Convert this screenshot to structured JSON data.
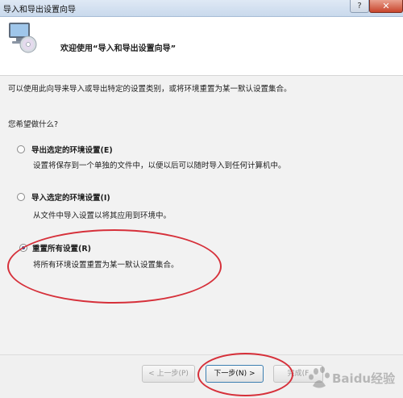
{
  "window": {
    "title": "导入和导出设置向导"
  },
  "header": {
    "title": "欢迎使用“导入和导出设置向导”"
  },
  "main": {
    "intro": "可以使用此向导来导入或导出特定的设置类别，或将环境重置为某一默认设置集合。",
    "question": "您希望做什么?",
    "options": [
      {
        "label": "导出选定的环境设置(E)",
        "desc": "设置将保存到一个单独的文件中，以便以后可以随时导入到任何计算机中。",
        "selected": false
      },
      {
        "label": "导入选定的环境设置(I)",
        "desc": "从文件中导入设置以将其应用到环境中。",
        "selected": false
      },
      {
        "label": "重置所有设置(R)",
        "desc": "将所有环境设置重置为某一默认设置集合。",
        "selected": true
      }
    ]
  },
  "footer": {
    "back": "< 上一步(P)",
    "next": "下一步(N) >",
    "finish": "完成(F"
  },
  "watermark": {
    "text": "Baidu经验"
  },
  "colors": {
    "annotation": "#d6303a",
    "header_bg": "#ffffff"
  }
}
